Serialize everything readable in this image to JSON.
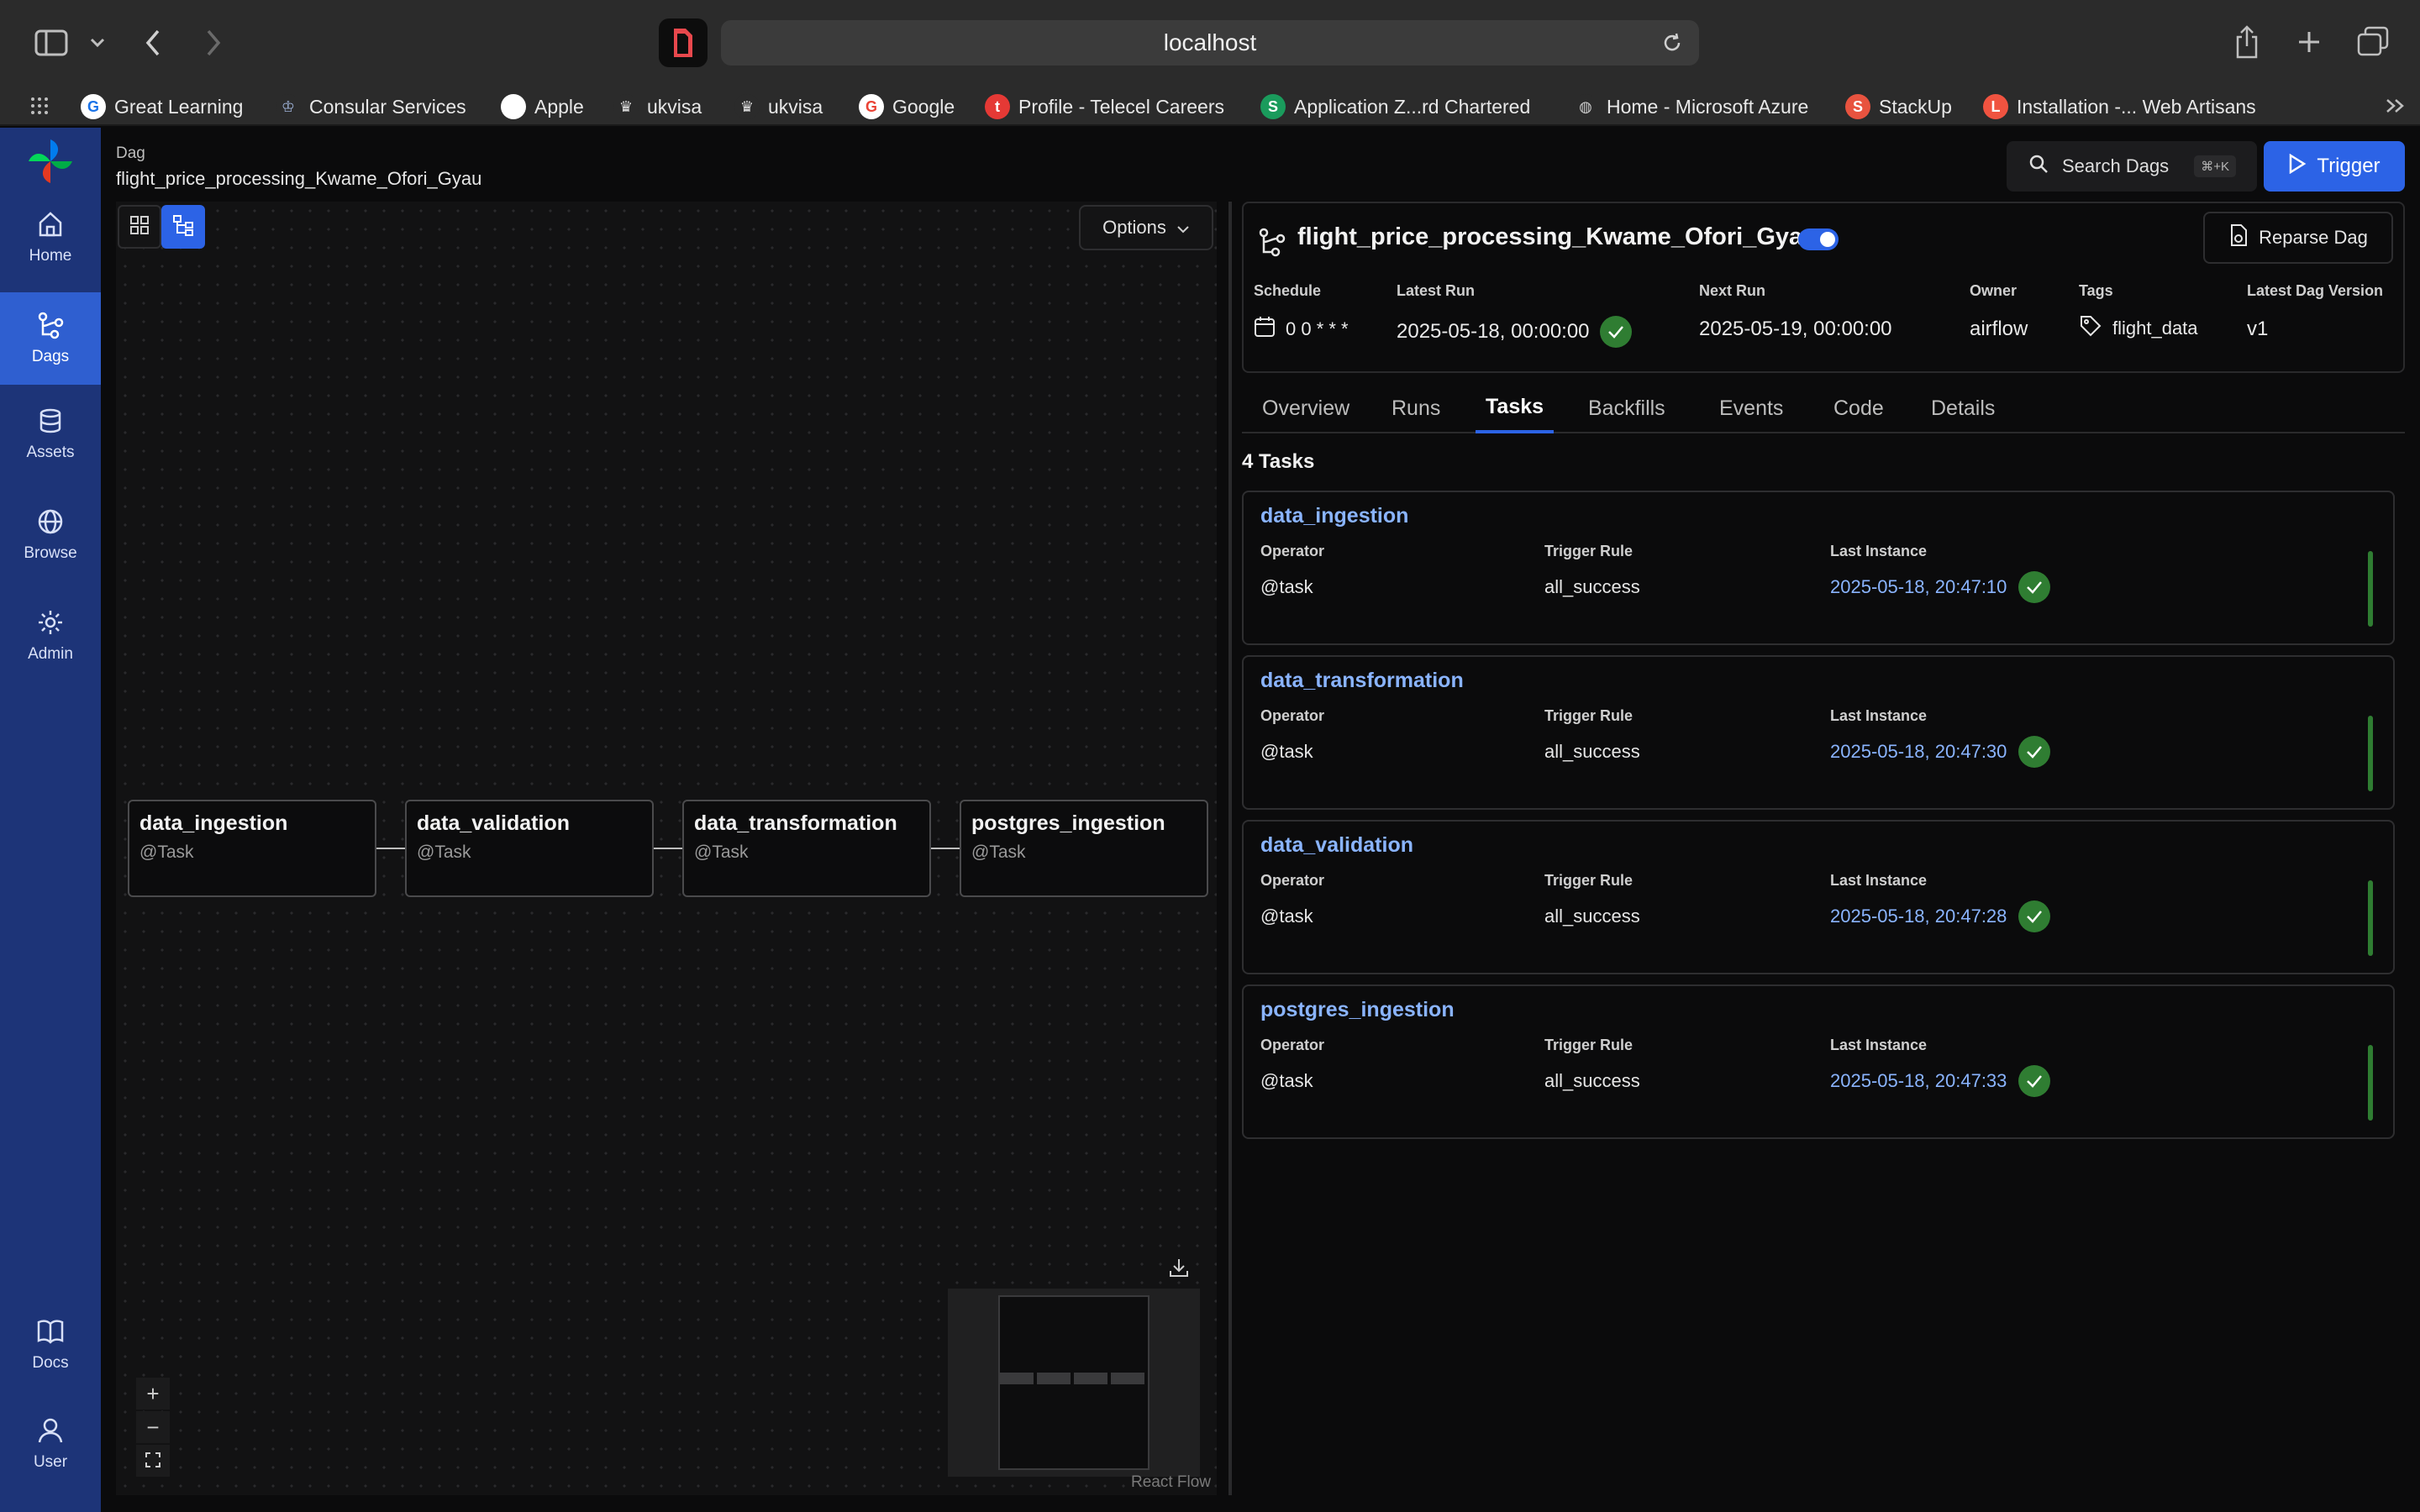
{
  "browser": {
    "address": "localhost",
    "bookmarks": [
      {
        "label": "Great Learning",
        "icon": "great-learning-icon",
        "glyph": "G",
        "color": "#ffffff",
        "fg": "#1a73e8"
      },
      {
        "label": "Consular Services",
        "icon": "consular-icon",
        "glyph": "♔",
        "color": "#2b2b2b",
        "fg": "#9fb3d9"
      },
      {
        "label": "Apple",
        "icon": "apple-icon",
        "glyph": "",
        "color": "#ffffff",
        "fg": "#222222"
      },
      {
        "label": "ukvisa",
        "icon": "crown-icon",
        "glyph": "♛",
        "color": "#2b2b2b",
        "fg": "#e0e0e0"
      },
      {
        "label": "ukvisa",
        "icon": "crown-icon",
        "glyph": "♛",
        "color": "#2b2b2b",
        "fg": "#e0e0e0"
      },
      {
        "label": "Google",
        "icon": "google-icon",
        "glyph": "G",
        "color": "#ffffff",
        "fg": "#ea4335"
      },
      {
        "label": "Profile - Telecel Careers",
        "icon": "telecel-icon",
        "glyph": "t",
        "color": "#e53935",
        "fg": "#ffffff"
      },
      {
        "label": "Application Z...rd Chartered",
        "icon": "standard-chartered-icon",
        "glyph": "S",
        "color": "#1a9b5c",
        "fg": "#ffffff"
      },
      {
        "label": "Home - Microsoft Azure",
        "icon": "globe-icon",
        "glyph": "◍",
        "color": "#2b2b2b",
        "fg": "#cfcfcf"
      },
      {
        "label": "StackUp",
        "icon": "stackup-icon",
        "glyph": "S",
        "color": "#e8533f",
        "fg": "#ffffff"
      },
      {
        "label": "Installation -... Web Artisans",
        "icon": "laravel-icon",
        "glyph": "L",
        "color": "#f05340",
        "fg": "#ffffff"
      }
    ]
  },
  "nav": {
    "items": [
      {
        "label": "Home",
        "icon": "home-icon"
      },
      {
        "label": "Dags",
        "icon": "dags-icon"
      },
      {
        "label": "Assets",
        "icon": "assets-icon"
      },
      {
        "label": "Browse",
        "icon": "browse-icon"
      },
      {
        "label": "Admin",
        "icon": "admin-icon"
      }
    ],
    "bottom": [
      {
        "label": "Docs",
        "icon": "docs-icon"
      },
      {
        "label": "User",
        "icon": "user-icon"
      }
    ]
  },
  "header": {
    "section_label": "Dag",
    "dag_id": "flight_price_processing_Kwame_Ofori_Gyau",
    "search_label": "Search Dags",
    "search_shortcut": "⌘+K",
    "trigger_label": "Trigger"
  },
  "graph": {
    "options_label": "Options",
    "nodes": [
      {
        "name": "data_ingestion",
        "operator": "@Task"
      },
      {
        "name": "data_validation",
        "operator": "@Task"
      },
      {
        "name": "data_transformation",
        "operator": "@Task"
      },
      {
        "name": "postgres_ingestion",
        "operator": "@Task"
      }
    ],
    "attribution": "React Flow"
  },
  "details": {
    "dag_name": "flight_price_processing_Kwame_Ofori_Gyau",
    "paused": false,
    "reparse_label": "Reparse Dag",
    "meta": {
      "schedule_label": "Schedule",
      "schedule_value": "0 0 * * *",
      "latest_run_label": "Latest Run",
      "latest_run_value": "2025-05-18, 00:00:00",
      "next_run_label": "Next Run",
      "next_run_value": "2025-05-19, 00:00:00",
      "owner_label": "Owner",
      "owner_value": "airflow",
      "tags_label": "Tags",
      "tags_value": "flight_data",
      "version_label": "Latest Dag Version",
      "version_value": "v1"
    },
    "tabs": [
      "Overview",
      "Runs",
      "Tasks",
      "Backfills",
      "Events",
      "Code",
      "Details"
    ],
    "active_tab": "Tasks",
    "task_count": "4 Tasks",
    "columns": {
      "operator": "Operator",
      "trigger_rule": "Trigger Rule",
      "last_instance": "Last Instance"
    },
    "tasks": [
      {
        "name": "data_ingestion",
        "operator": "@task",
        "trigger_rule": "all_success",
        "last_instance": "2025-05-18, 20:47:10"
      },
      {
        "name": "data_transformation",
        "operator": "@task",
        "trigger_rule": "all_success",
        "last_instance": "2025-05-18, 20:47:30"
      },
      {
        "name": "data_validation",
        "operator": "@task",
        "trigger_rule": "all_success",
        "last_instance": "2025-05-18, 20:47:28"
      },
      {
        "name": "postgres_ingestion",
        "operator": "@task",
        "trigger_rule": "all_success",
        "last_instance": "2025-05-18, 20:47:33"
      }
    ]
  },
  "colors": {
    "accent": "#2c63e6",
    "success": "#2f7d32",
    "nav_bg": "#1d3478",
    "link": "#8ab4ff"
  }
}
